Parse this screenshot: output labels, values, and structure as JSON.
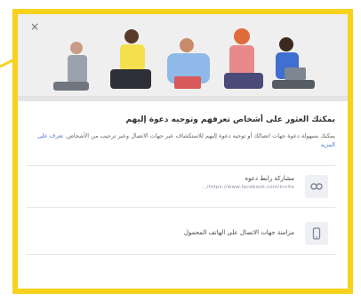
{
  "header": {
    "close_label": "×"
  },
  "main": {
    "title": "يمكنك العثور على أشخاص تعرفهم وتوجيه دعوة إليهم",
    "description": "يمكنك بسهولة دعوة جهات اتصالك أو توجيه دعوة إليهم للاستكشاف عبر جهات الاتصال وعبر ترحيب من الأشخاص.",
    "description_link": "تعرف على المزيد"
  },
  "options": [
    {
      "label": "مشاركة رابط دعوة",
      "sublabel": "https://www.facebook.com/invite/...",
      "icon": "link-icon"
    },
    {
      "label": "مزامنة جهات الاتصال على الهاتف المحمول",
      "icon": "phone-icon"
    }
  ],
  "colors": {
    "frame": "#f7d21c",
    "hero_bg": "#efefef",
    "link": "#4f7ac7"
  }
}
